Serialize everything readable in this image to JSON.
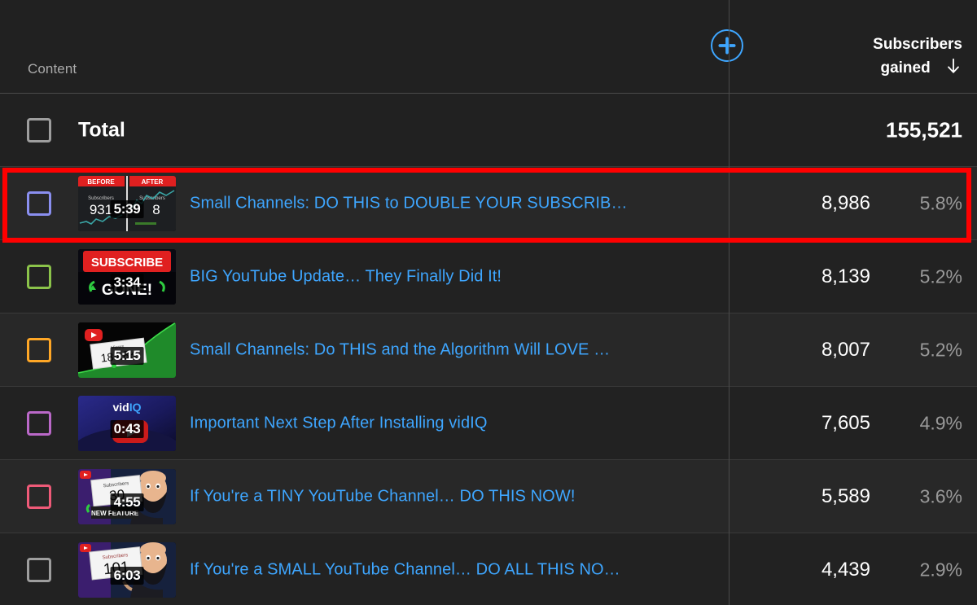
{
  "header": {
    "content_label": "Content",
    "metric_label_line1": "Subscribers",
    "metric_label_line2": "gained",
    "sort_direction": "descending",
    "add_metric_icon": "plus-circle-icon",
    "sort_icon": "arrow-down-icon"
  },
  "total_row": {
    "label": "Total",
    "subscribers_gained": "155,521",
    "checkbox_color": "#9e9e9e"
  },
  "colors": {
    "link_blue": "#3ea6ff",
    "highlight_red": "#ff0000",
    "page_bg": "#212121",
    "row_bg": "#282828",
    "row_bg_alt": "#222222",
    "muted_text": "#999999"
  },
  "rows": [
    {
      "checkbox_color": "#8a8ff0",
      "title": "Small Channels: DO THIS to DOUBLE YOUR SUBSCRIB…",
      "subscribers_gained": "8,986",
      "percent": "5.8%",
      "duration": "5:39",
      "thumbnail": {
        "style": "before-after",
        "badge_left": "BEFORE",
        "badge_right": "AFTER",
        "caption_left": "Subscribers",
        "caption_right": "Subscribers",
        "number_left": "931",
        "number_right": "8"
      },
      "highlighted": true
    },
    {
      "checkbox_color": "#8bc34a",
      "title": "BIG YouTube Update… They Finally Did It!",
      "subscribers_gained": "8,139",
      "percent": "5.2%",
      "duration": "3:34",
      "thumbnail": {
        "style": "subscribe-gone",
        "banner_text": "SUBSCRIBE",
        "big_text": "GONE!"
      },
      "highlighted": false
    },
    {
      "checkbox_color": "#ffa726",
      "title": "Small Channels: Do THIS and the Algorithm Will LOVE …",
      "subscribers_gained": "8,007",
      "percent": "5.2%",
      "duration": "5:15",
      "thumbnail": {
        "style": "views-card",
        "caption": "Views",
        "number": "184.8K"
      },
      "highlighted": false
    },
    {
      "checkbox_color": "#ba68c8",
      "title": "Important Next Step After Installing vidIQ",
      "subscribers_gained": "7,605",
      "percent": "4.9%",
      "duration": "0:43",
      "thumbnail": {
        "style": "vidiq-logo",
        "logo_text": "vidIQ"
      },
      "highlighted": false
    },
    {
      "checkbox_color": "#ef5a78",
      "title": "If You're a TINY YouTube Channel… DO THIS NOW!",
      "subscribers_gained": "5,589",
      "percent": "3.6%",
      "duration": "4:55",
      "thumbnail": {
        "style": "sign-person",
        "caption": "Subscribers",
        "number": "30",
        "sub_banner": "NEW FEATURE"
      },
      "highlighted": false
    },
    {
      "checkbox_color": "#9e9e9e",
      "title": "If You're a SMALL YouTube Channel… DO ALL THIS NO…",
      "subscribers_gained": "4,439",
      "percent": "2.9%",
      "duration": "6:03",
      "thumbnail": {
        "style": "sign-person",
        "caption": "Subscribers",
        "number": "101",
        "sub_banner": ""
      },
      "highlighted": false
    }
  ]
}
